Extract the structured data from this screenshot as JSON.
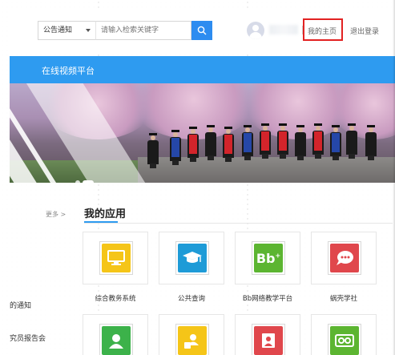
{
  "header": {
    "search_category": "公告通知",
    "search_placeholder": "请输入检索关键字",
    "my_home_label": "我的主页",
    "logout_label": "退出登录"
  },
  "navbar": {
    "title": "在线视频平台"
  },
  "left": {
    "more_label": "更多 >",
    "items": [
      "的通知",
      "究员报告会"
    ]
  },
  "apps": {
    "section_title": "我的应用",
    "items": [
      {
        "label": "综合教务系统",
        "icon": "monitor-icon",
        "color": "#f5c518"
      },
      {
        "label": "公共查询",
        "icon": "graduation-cap-icon",
        "color": "#1e9bd7"
      },
      {
        "label": "Bb网络教学平台",
        "icon": "bb-icon",
        "color": "#5cb531"
      },
      {
        "label": "蜗壳学社",
        "icon": "chat-bubble-icon",
        "color": "#e0474c"
      },
      {
        "label": "",
        "icon": "user-contact-icon",
        "color": "#3cb24a"
      },
      {
        "label": "",
        "icon": "user-card-icon",
        "color": "#f5c518"
      },
      {
        "label": "",
        "icon": "id-card-icon",
        "color": "#e0474c"
      },
      {
        "label": "",
        "icon": "vr-glasses-icon",
        "color": "#5cb531"
      }
    ]
  }
}
